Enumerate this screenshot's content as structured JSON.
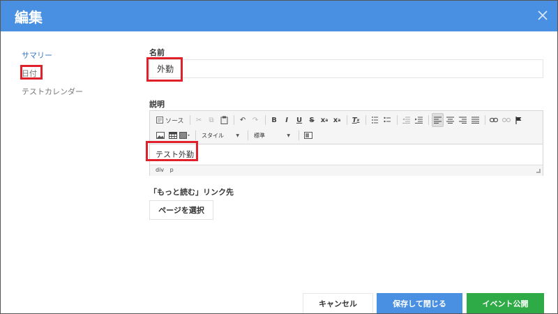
{
  "dialog": {
    "title": "編集"
  },
  "sidebar": {
    "items": [
      {
        "label": "サマリー"
      },
      {
        "label": "日付"
      },
      {
        "label": "テストカレンダー"
      }
    ]
  },
  "name_field": {
    "label": "名前",
    "value": "外勤"
  },
  "description": {
    "label": "説明",
    "toolbar": {
      "source_label": "ソース",
      "bold_label": "B",
      "italic_label": "I",
      "underline_label": "U",
      "strike_label": "S",
      "style_combo": "スタイル",
      "format_combo": "標準"
    },
    "content": "テスト外勤",
    "path": [
      "div",
      "p"
    ]
  },
  "read_more": {
    "label": "「もっと読む」リンク先",
    "select_page_button": "ページを選択"
  },
  "footer": {
    "cancel_label": "キャンセル",
    "save_close_label": "保存して閉じる",
    "publish_label": "イベント公開"
  },
  "colors": {
    "header": "#4a90e2",
    "save": "#4a90e2",
    "publish": "#2eaa46",
    "highlight": "#e0202a"
  }
}
